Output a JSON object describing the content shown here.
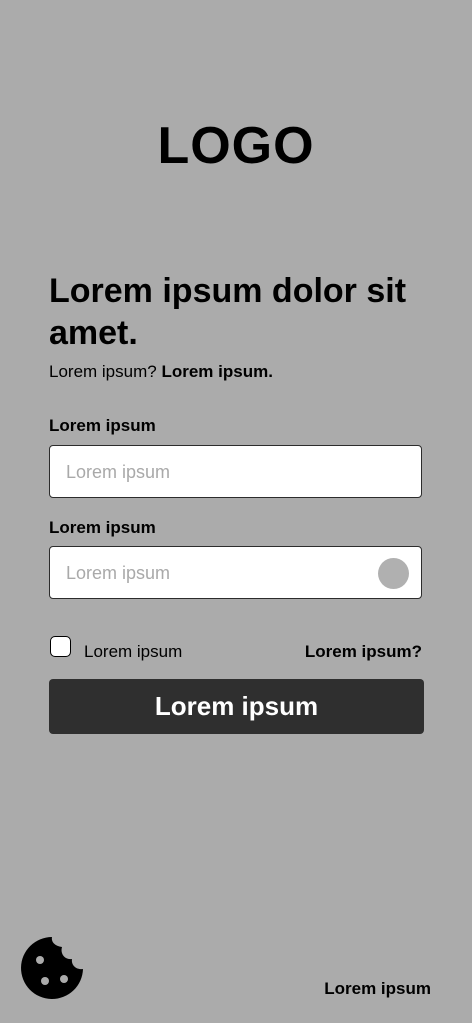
{
  "logo": "LOGO",
  "heading": "Lorem ipsum dolor sit amet.",
  "subline": {
    "text": "Lorem ipsum?",
    "link": "Lorem ipsum."
  },
  "form": {
    "field1": {
      "label": "Lorem ipsum",
      "placeholder": "Lorem ipsum",
      "value": ""
    },
    "field2": {
      "label": "Lorem ipsum",
      "placeholder": "Lorem ipsum",
      "value": ""
    },
    "checkbox": {
      "label": "Lorem ipsum",
      "checked": false
    },
    "forgot_link": "Lorem ipsum?",
    "submit_label": "Lorem ipsum"
  },
  "footer": {
    "cookie_icon": "cookie-icon",
    "link": "Lorem ipsum"
  },
  "colors": {
    "background": "#ababab",
    "button": "#2f2f2f",
    "field_bg": "#ffffff"
  }
}
